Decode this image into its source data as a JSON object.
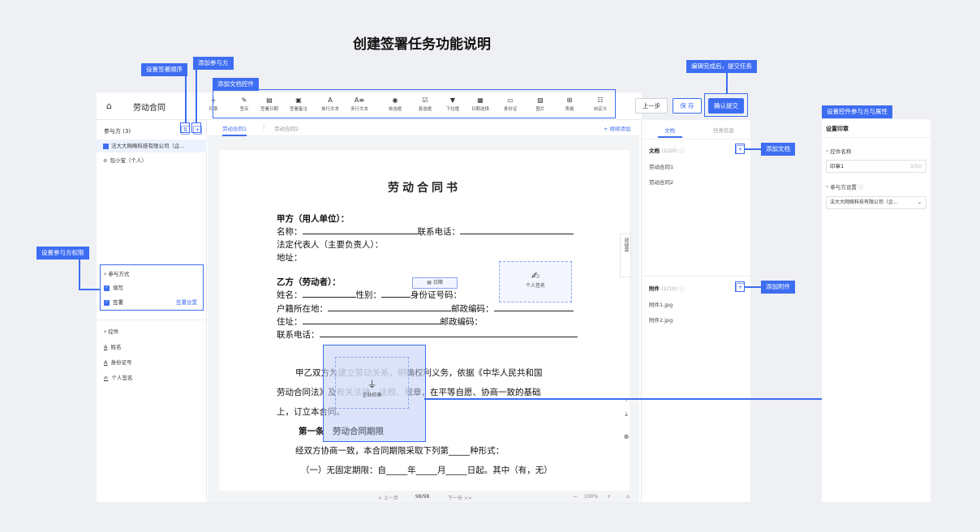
{
  "page_title": "创建签署任务功能说明",
  "callouts": {
    "add_doc_controls": "添加文档控件",
    "set_sign_order": "设置签署顺序",
    "add_party": "添加参与方",
    "submit_note": "编辑完成后，提交任务",
    "set_party_perm": "设置参与方权限",
    "add_document": "添加文档",
    "add_attachment": "添加附件",
    "set_control_props": "设置控件参与方与属性"
  },
  "header": {
    "doc_name": "劳动合同",
    "prev_label": "上一步",
    "save_label": "保 存",
    "confirm_label": "确认提交"
  },
  "toolbar": [
    {
      "icon": "seal-icon",
      "glyph": "⏚",
      "label": "印章"
    },
    {
      "icon": "pen-icon",
      "glyph": "✎",
      "label": "签名"
    },
    {
      "icon": "calendar-icon",
      "glyph": "▤",
      "label": "签署日期"
    },
    {
      "icon": "note-icon",
      "glyph": "▣",
      "label": "签署备注"
    },
    {
      "icon": "text-icon",
      "glyph": "A",
      "label": "单行文本"
    },
    {
      "icon": "multitext-icon",
      "glyph": "A≡",
      "label": "多行文本"
    },
    {
      "icon": "radio-icon",
      "glyph": "◉",
      "label": "单选框"
    },
    {
      "icon": "checkbox-icon",
      "glyph": "☑",
      "label": "复选框"
    },
    {
      "icon": "dropdown-icon",
      "glyph": "▼",
      "label": "下拉框"
    },
    {
      "icon": "date-select-icon",
      "glyph": "▦",
      "label": "日期选择"
    },
    {
      "icon": "id-card-icon",
      "glyph": "▭",
      "label": "身份证"
    },
    {
      "icon": "image-icon",
      "glyph": "▨",
      "label": "图片"
    },
    {
      "icon": "table-icon",
      "glyph": "⊞",
      "label": "表格"
    },
    {
      "icon": "custom-icon",
      "glyph": "☷",
      "label": "自定义"
    }
  ],
  "left_panel": {
    "parties_title": "参与方 (3)",
    "parties": [
      "法大大网络科技有限公司（企...",
      "包小宝（个人）"
    ],
    "party_mode_title": "参与方式",
    "options": [
      "填写",
      "签署"
    ],
    "sign_settings": "签署设置",
    "controls_title": "控件",
    "controls": [
      {
        "icon": "text-icon",
        "glyph": "A",
        "label": "姓名"
      },
      {
        "icon": "text-icon",
        "glyph": "A",
        "label": "身份证号"
      },
      {
        "icon": "signature-icon",
        "glyph": "✍",
        "label": "个人签名"
      }
    ]
  },
  "center": {
    "tabs": [
      "劳动合同1",
      "劳动合同2"
    ],
    "continue_add": "+ 继续添加",
    "doc_title": "劳动合同书",
    "party_a": "甲方（用人单位）：",
    "name_label": "名称：",
    "phone_label": "联系电话：",
    "legal_rep": "法定代表人（主要负责人）：",
    "address": "地址：",
    "party_b": "乙方（劳动者）：",
    "person_name": "姓名：",
    "gender": "性别：",
    "id_no": "身份证号码：",
    "household": "户籍所在地：",
    "postcode": "邮政编码：",
    "residence": "住址：",
    "phone2": "联系电话：",
    "para1": "甲乙双方为建立劳动关系，明确权利义务，依据《中华人民共和国",
    "para2": "劳动合同法》及有关法律、法规、规章，在平等自愿、协商一致的基础",
    "para3": "上，订立本合同。",
    "article1": "第一条　劳动合同期限",
    "para4": "经双方协商一致，本合同期限采取下列第_____种形式：",
    "para5": "（一）无固定期限：自_____年_____月_____日起。其中（有，无）",
    "date_ctrl": "日期",
    "personal_sig": "个人签名",
    "company_seal": "企业印章",
    "side_text": "骑缝章",
    "footer": {
      "prev": "< 上一页",
      "page": "98/98",
      "next": "下一份 >>",
      "zoom": "100%"
    }
  },
  "right_panel": {
    "tab_docs": "文档",
    "tab_info": "任务信息",
    "docs_title": "文档",
    "docs_count": "(2/20)",
    "docs": [
      "劳动合同1",
      "劳动合同2"
    ],
    "attach_title": "附件",
    "attach_count": "(2/10)",
    "attachments": [
      "附件1.jpg",
      "附件2.jpg"
    ]
  },
  "far_panel": {
    "title": "设置印章",
    "name_label": "控件名称",
    "name_value": "印章1",
    "name_count": "3/50",
    "party_label": "参与方设置",
    "party_value": "法大大网络科技有限公司（企..."
  }
}
